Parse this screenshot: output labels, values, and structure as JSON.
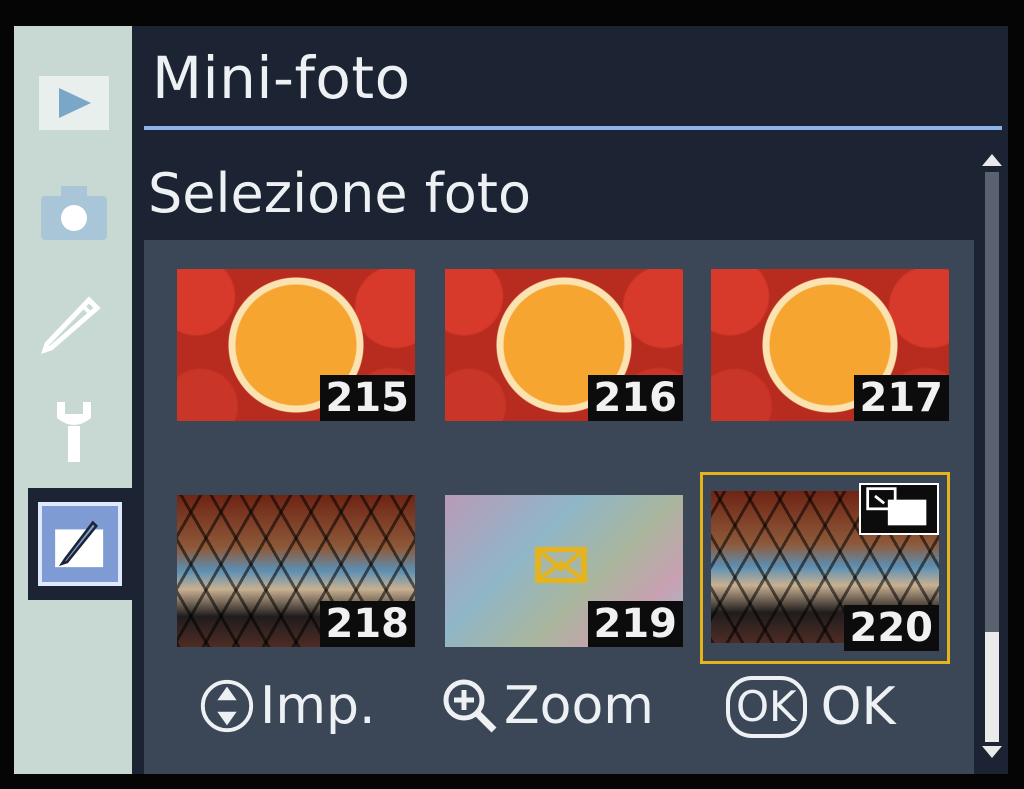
{
  "header": {
    "title": "Mini-foto",
    "subtitle": "Selezione foto"
  },
  "sidebar": {
    "items": [
      {
        "name": "playback",
        "icon": "play-icon"
      },
      {
        "name": "shooting",
        "icon": "camera-icon"
      },
      {
        "name": "custom",
        "icon": "pencil-icon"
      },
      {
        "name": "setup",
        "icon": "wrench-icon"
      },
      {
        "name": "retouch",
        "icon": "retouch-brush-icon",
        "active": true
      }
    ]
  },
  "thumbnails": [
    {
      "number": "215",
      "subject": "orange"
    },
    {
      "number": "216",
      "subject": "orange"
    },
    {
      "number": "217",
      "subject": "orange"
    },
    {
      "number": "218",
      "subject": "dome"
    },
    {
      "number": "219",
      "subject": "pastel"
    },
    {
      "number": "220",
      "subject": "dome",
      "selected": true
    }
  ],
  "footer": {
    "set_label": "Imp.",
    "zoom_label": "Zoom",
    "ok_badge": "OK",
    "ok_label": "OK"
  },
  "colors": {
    "accent": "#e5b31c",
    "rule": "#8fb3e6",
    "background": "#1c2433"
  }
}
